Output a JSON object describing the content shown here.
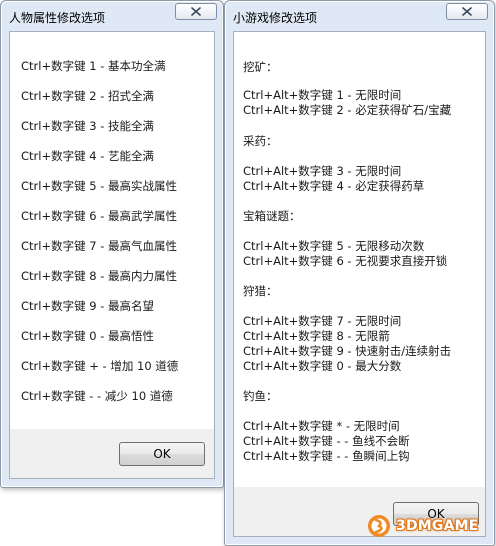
{
  "dialog_left": {
    "title": "人物属性修改选项",
    "lines": [
      "Ctrl+数字键 1 - 基本功全满",
      "Ctrl+数字键 2 - 招式全满",
      "Ctrl+数字键 3 - 技能全满",
      "Ctrl+数字键 4 - 艺能全满",
      "Ctrl+数字键 5 - 最高实战属性",
      "Ctrl+数字键 6 - 最高武学属性",
      "Ctrl+数字键 7 - 最高气血属性",
      "Ctrl+数字键 8 - 最高内力属性",
      "Ctrl+数字键 9 - 最高名望",
      "Ctrl+数字键 0 - 最高悟性",
      "Ctrl+数字键 + - 增加 10 道德",
      "Ctrl+数字键 - - 减少 10 道德"
    ],
    "ok_label": "OK"
  },
  "dialog_right": {
    "title": "小游戏修改选项",
    "lines": [
      "挖矿：",
      "Ctrl+Alt+数字键 1 - 无限时间",
      "Ctrl+Alt+数字键 2 - 必定获得矿石/宝藏",
      "采药：",
      "Ctrl+Alt+数字键 3 - 无限时间",
      "Ctrl+Alt+数字键 4 - 必定获得药草",
      "宝箱谜题：",
      "Ctrl+Alt+数字键 5 - 无限移动次数",
      "Ctrl+Alt+数字键 6 - 无视要求直接开锁",
      "狩猎：",
      "Ctrl+Alt+数字键 7 - 无限时间",
      "Ctrl+Alt+数字键 8 - 无限箭",
      "Ctrl+Alt+数字键 9 - 快速射击/连续射击",
      "Ctrl+Alt+数字键 0 - 最大分数",
      "钓鱼：",
      "Ctrl+Alt+数字键 * - 无限时间",
      "Ctrl+Alt+数字键 - - 鱼线不会断",
      "Ctrl+Alt+数字键 - - 鱼瞬间上钩"
    ],
    "ok_label": "OK"
  },
  "watermark": {
    "text": "3DMGAME",
    "icon": "3dm-logo-icon",
    "color": "#e0781c"
  }
}
